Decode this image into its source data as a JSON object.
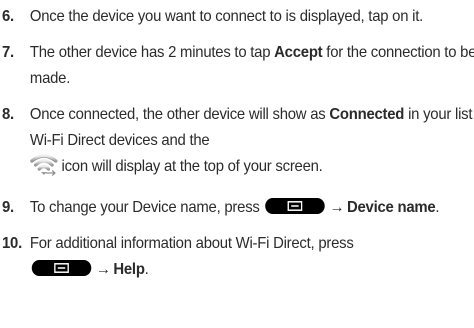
{
  "steps": [
    {
      "number": "6.",
      "text": "Once the device you want to connect to is displayed, tap on it."
    },
    {
      "number": "7.",
      "text_before": "The other device has 2 minutes to tap ",
      "bold": "Accept",
      "text_after": " for the connection to be made."
    },
    {
      "number": "8.",
      "text_before": "Once connected, the other device will show as ",
      "bold": "Connected",
      "text_middle": " in your list of Wi-Fi Direct devices and the",
      "text_after": "icon will display at the top of your screen.",
      "icon": "wifi-direct-icon"
    },
    {
      "number": "9.",
      "text_before": "To change your Device name, press",
      "arrow": "→",
      "bold": "Device name",
      "text_after": ".",
      "icon": "menu-key-icon"
    },
    {
      "number": "10.",
      "text_before": "For additional information about Wi-Fi Direct, press",
      "arrow": "→",
      "bold": "Help",
      "text_after": ".",
      "icon": "menu-key-icon"
    }
  ]
}
